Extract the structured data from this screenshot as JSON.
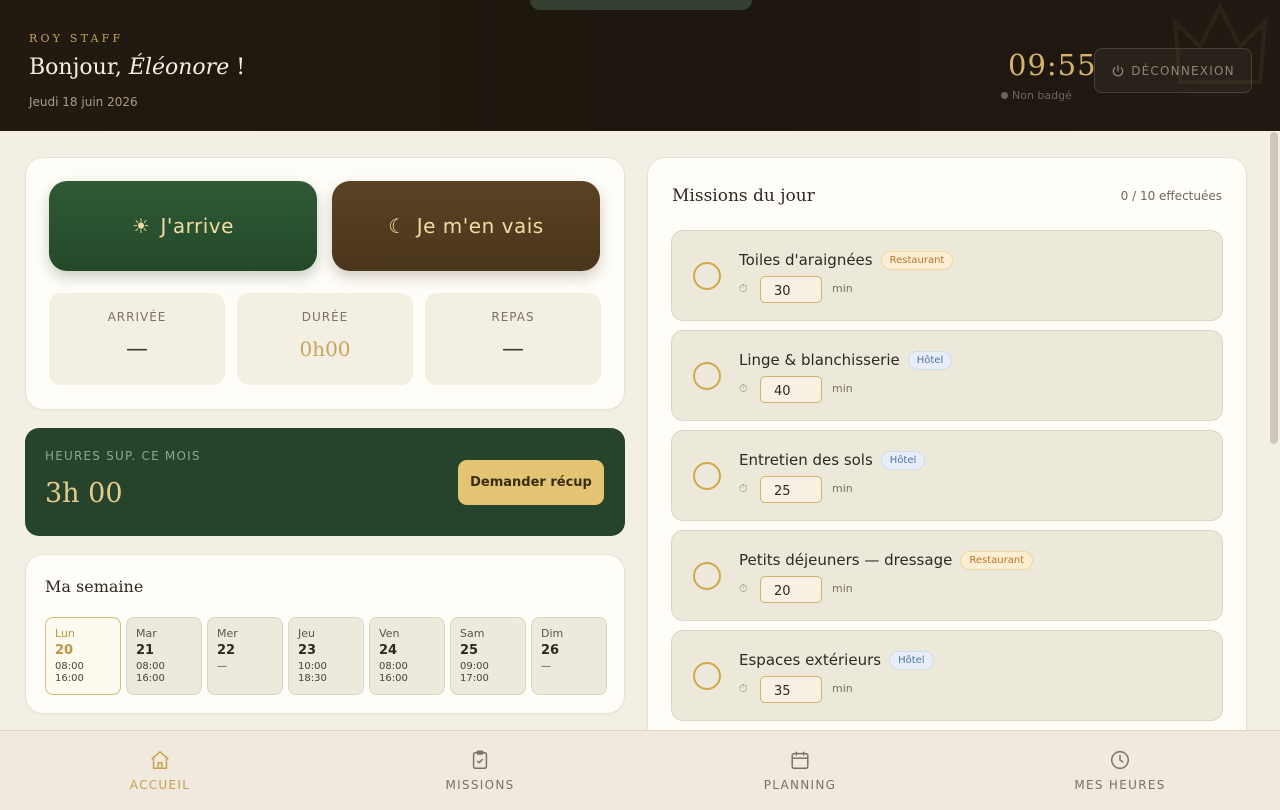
{
  "header": {
    "brand": "ROY STAFF",
    "greeting_prefix": "Bonjour, ",
    "greeting_name": "Éléonore",
    "greeting_suffix": " !",
    "date": "Jeudi 18 juin 2026",
    "clock": "09:55",
    "badge_status": "Non badgé",
    "logout_label": "DÉCONNEXION"
  },
  "clock_actions": {
    "arrive_label": "J'arrive",
    "leave_label": "Je m'en vais"
  },
  "stats": [
    {
      "label": "ARRIVÉE",
      "value": "—"
    },
    {
      "label": "DURÉE",
      "value": "0h00"
    },
    {
      "label": "REPAS",
      "value": "—"
    }
  ],
  "overtime": {
    "label": "HEURES SUP. CE MOIS",
    "value": "3h 00",
    "button_label": "Demander récup"
  },
  "week": {
    "title": "Ma semaine",
    "days": [
      {
        "name": "Lun",
        "date": "20",
        "start": "08:00",
        "end": "16:00",
        "today": true
      },
      {
        "name": "Mar",
        "date": "21",
        "start": "08:00",
        "end": "16:00"
      },
      {
        "name": "Mer",
        "date": "22",
        "start": "—",
        "end": ""
      },
      {
        "name": "Jeu",
        "date": "23",
        "start": "10:00",
        "end": "18:30"
      },
      {
        "name": "Ven",
        "date": "24",
        "start": "08:00",
        "end": "16:00"
      },
      {
        "name": "Sam",
        "date": "25",
        "start": "09:00",
        "end": "17:00"
      },
      {
        "name": "Dim",
        "date": "26",
        "start": "—",
        "end": ""
      }
    ]
  },
  "missions": {
    "title": "Missions du jour",
    "count": "0 / 10 effectuées",
    "unit": "min",
    "items": [
      {
        "name": "Toiles d'araignées",
        "tag": "Restaurant",
        "minutes": "30"
      },
      {
        "name": "Linge & blanchisserie",
        "tag": "Hôtel",
        "minutes": "40"
      },
      {
        "name": "Entretien des sols",
        "tag": "Hôtel",
        "minutes": "25"
      },
      {
        "name": "Petits déjeuners — dressage",
        "tag": "Restaurant",
        "minutes": "20"
      },
      {
        "name": "Espaces extérieurs",
        "tag": "Hôtel",
        "minutes": "35"
      }
    ]
  },
  "nav": {
    "items": [
      {
        "label": "ACCUEIL",
        "icon": "home-icon",
        "active": true
      },
      {
        "label": "MISSIONS",
        "icon": "clipboard-check-icon"
      },
      {
        "label": "PLANNING",
        "icon": "calendar-icon"
      },
      {
        "label": "MES HEURES",
        "icon": "clock-icon"
      }
    ]
  },
  "colors": {
    "header_bg": "#1c160e",
    "gold": "#c8a55b",
    "green": "#26442c",
    "brown": "#4a361d",
    "page_bg": "#f3efe5"
  }
}
